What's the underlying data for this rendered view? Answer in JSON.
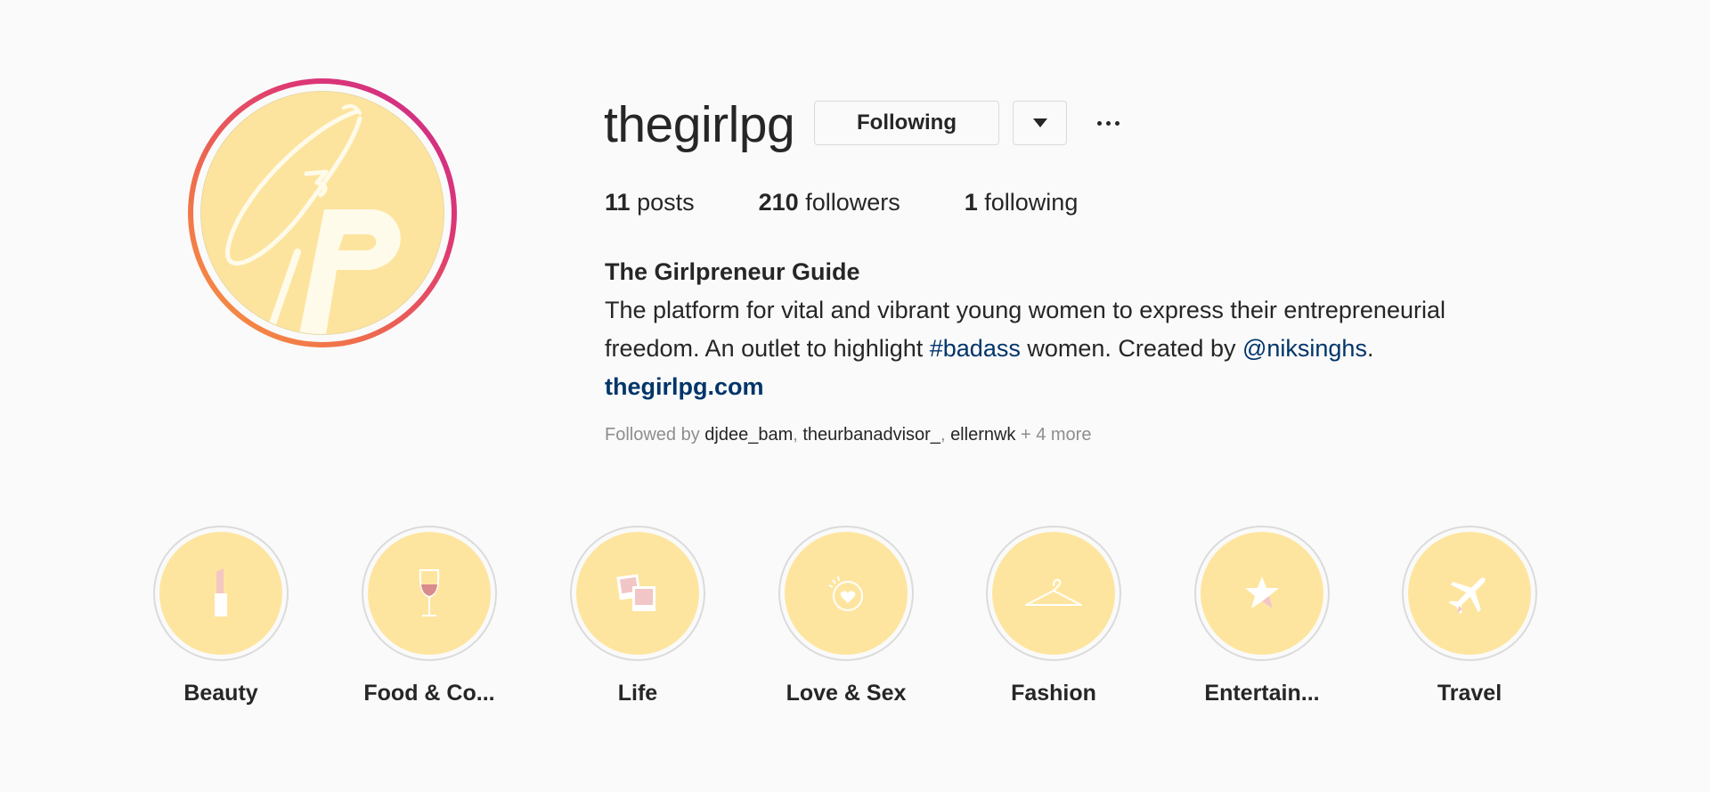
{
  "profile": {
    "username": "thegirlpg",
    "avatar_icon": "gp-monogram-logo",
    "following_button": "Following",
    "dropdown_icon": "chevron-down-icon",
    "more_icon": "more-options-icon"
  },
  "stats": {
    "posts_count": "11",
    "posts_label": "posts",
    "followers_count": "210",
    "followers_label": "followers",
    "following_count": "1",
    "following_label": "following"
  },
  "bio": {
    "full_name": "The Girlpreneur Guide",
    "line1": "The platform for vital and vibrant young women to express their entrepreneurial",
    "line2_pre": "freedom. An outlet to highlight ",
    "hashtag": "#badass",
    "line2_mid": " women. Created by ",
    "mention": "@niksinghs",
    "line2_post": ".",
    "website": "thegirlpg.com"
  },
  "followed_by": {
    "prefix": "Followed by ",
    "users": [
      "djdee_bam",
      "theurbanadvisor_",
      "ellernwk"
    ],
    "sep": ", ",
    "more": " + 4 more"
  },
  "highlights": [
    {
      "label": "Beauty",
      "icon": "lipstick-icon"
    },
    {
      "label": "Food & Co...",
      "icon": "wine-glass-icon"
    },
    {
      "label": "Life",
      "icon": "photos-icon"
    },
    {
      "label": "Love & Sex",
      "icon": "heart-icon"
    },
    {
      "label": "Fashion",
      "icon": "hanger-icon"
    },
    {
      "label": "Entertain...",
      "icon": "star-icon"
    },
    {
      "label": "Travel",
      "icon": "airplane-icon"
    }
  ],
  "colors": {
    "background": "#fafafa",
    "highlight_fill": "#fee59f",
    "link_blue": "#003569",
    "muted_text": "#8e8e8e",
    "story_ring_start": "#f99b3d",
    "story_ring_end": "#c92d8e"
  }
}
